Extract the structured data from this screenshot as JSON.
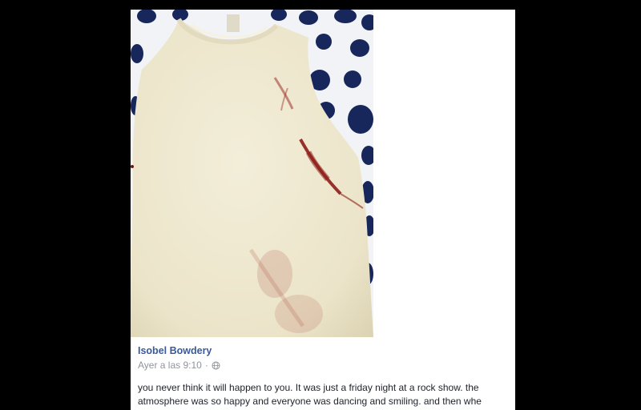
{
  "post": {
    "author_name": "Isobel Bowdery",
    "timestamp": "Ayer a las 9:10",
    "separator": "·",
    "privacy_icon": "globe-icon",
    "text_lines": [
      "you never think it will happen to you. It was just a friday night at a rock show. the",
      "atmosphere was so happy and everyone was dancing and smiling. and then whe"
    ],
    "photo": {
      "subject": "cream sleeveless top with blood stains on navy polka-dot fabric",
      "colors": {
        "garment": "#efe9d2",
        "polka_bg": "#f2f3f6",
        "dots": "#17275c",
        "stain": "#8e1d18"
      }
    }
  },
  "colors": {
    "page_background": "#000000",
    "card_background": "#ffffff",
    "author_link": "#3b5998",
    "meta_text": "#90949c",
    "body_text": "#1d2129"
  }
}
